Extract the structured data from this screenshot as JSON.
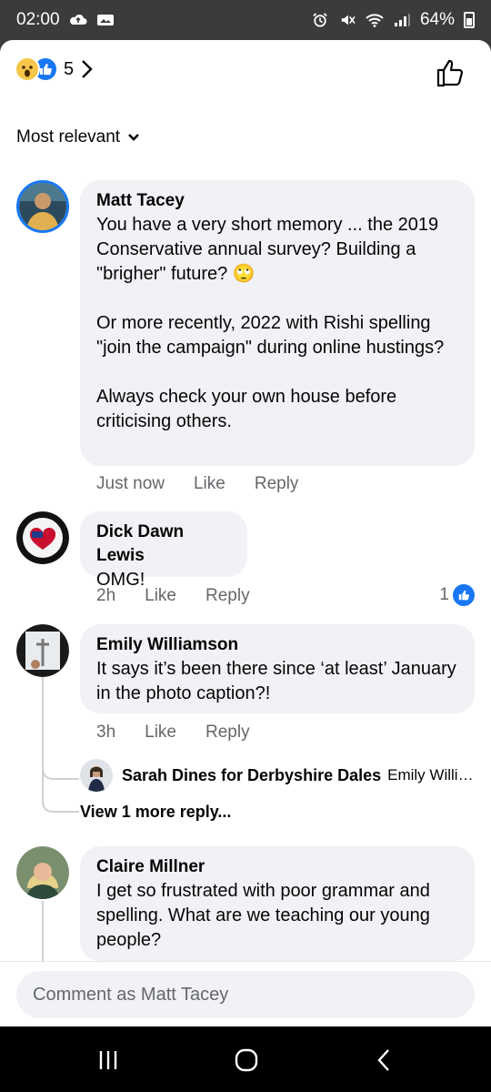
{
  "status_bar": {
    "time": "02:00",
    "battery": "64%"
  },
  "reactions": {
    "count": "5",
    "icons": [
      "wow-emoji",
      "like-emoji"
    ]
  },
  "sort": {
    "label": "Most relevant"
  },
  "comments": [
    {
      "name": "Matt Tacey",
      "text": "You have a very short memory ... the 2019 Conservative annual survey? Building a \"brigher\" future? 🙄\n\nOr more recently, 2022 with Rishi spelling \"join the campaign\" during online hustings?\n\nAlways check your own house before criticising others.",
      "time": "Just now",
      "like": "Like",
      "reply": "Reply"
    },
    {
      "name": "Dick Dawn Lewis",
      "text": "OMG!",
      "time": "2h",
      "like": "Like",
      "reply": "Reply",
      "reaction_count": "1"
    },
    {
      "name": "Emily Williamson",
      "text": "It says it’s been there since ‘at least’ January in the photo caption?!",
      "time": "3h",
      "like": "Like",
      "reply": "Reply"
    },
    {
      "name": "Claire Millner",
      "text": "I get so frustrated with poor grammar and spelling. What are we teaching our young people?"
    }
  ],
  "reply_preview": {
    "name": "Sarah Dines for Derbyshire Dales",
    "snippet": "Emily Williamson"
  },
  "view_more": "View 1 more reply...",
  "composer": {
    "placeholder": "Comment as Matt Tacey"
  },
  "colors": {
    "accent": "#1877f2",
    "bubble": "#f0f2f5",
    "meta": "#65676b"
  }
}
